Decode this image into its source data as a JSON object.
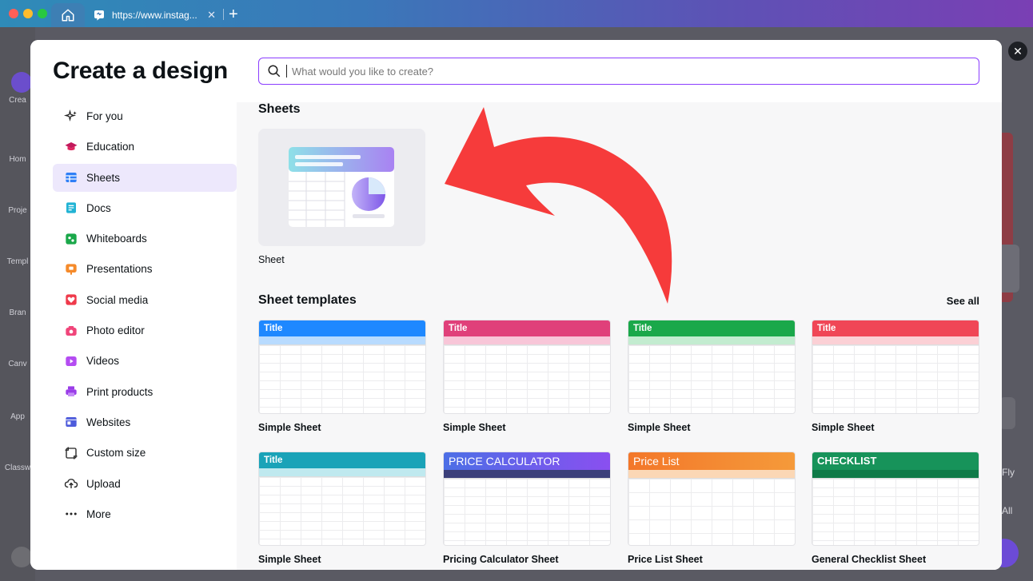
{
  "browser": {
    "tab_url": "https://www.instag...",
    "colors": {
      "close": "#ff5f57",
      "min": "#febc2e",
      "max": "#28c840"
    }
  },
  "background_app": {
    "sidebar_labels": [
      "Crea",
      "Hom",
      "Proje",
      "Templ",
      "Bran",
      "Canv",
      "App",
      "Classw"
    ],
    "right_labels": [
      "Fly",
      "All"
    ]
  },
  "modal": {
    "title": "Create a design",
    "search_placeholder": "What would you like to create?",
    "nav": [
      {
        "label": "For you",
        "icon": "sparkles-icon",
        "active": false
      },
      {
        "label": "Education",
        "icon": "graduation-cap-icon",
        "active": false
      },
      {
        "label": "Sheets",
        "icon": "sheets-icon",
        "active": true
      },
      {
        "label": "Docs",
        "icon": "docs-icon",
        "active": false
      },
      {
        "label": "Whiteboards",
        "icon": "whiteboard-icon",
        "active": false
      },
      {
        "label": "Presentations",
        "icon": "presentation-icon",
        "active": false
      },
      {
        "label": "Social media",
        "icon": "heart-icon",
        "active": false
      },
      {
        "label": "Photo editor",
        "icon": "camera-icon",
        "active": false
      },
      {
        "label": "Videos",
        "icon": "video-icon",
        "active": false
      },
      {
        "label": "Print products",
        "icon": "printer-icon",
        "active": false
      },
      {
        "label": "Websites",
        "icon": "website-icon",
        "active": false
      },
      {
        "label": "Custom size",
        "icon": "crop-icon",
        "active": false
      },
      {
        "label": "Upload",
        "icon": "cloud-upload-icon",
        "active": false
      },
      {
        "label": "More",
        "icon": "more-dots-icon",
        "active": false
      }
    ],
    "sheets_section": {
      "title": "Sheets",
      "card_label": "Sheet"
    },
    "templates_section": {
      "title": "Sheet templates",
      "see_all": "See all",
      "templates": [
        {
          "name": "Simple Sheet",
          "header": "Title",
          "color": "#1e88ff"
        },
        {
          "name": "Simple Sheet",
          "header": "Title",
          "color": "#e0407a"
        },
        {
          "name": "Simple Sheet",
          "header": "Title",
          "color": "#1aa84a"
        },
        {
          "name": "Simple Sheet",
          "header": "Title",
          "color": "#f04656"
        },
        {
          "name": "Simple Sheet",
          "header": "Title",
          "color": "#1aa3b8"
        },
        {
          "name": "Pricing Calculator Sheet",
          "header": "PRICE CALCULATOR",
          "color": "#5b5bdc"
        },
        {
          "name": "Price List Sheet",
          "header": "Price List",
          "color": "#f3772a"
        },
        {
          "name": "General Checklist Sheet",
          "header": "CHECKLIST",
          "color": "#17935a"
        }
      ]
    }
  },
  "colors": {
    "accent": "#8b3dff",
    "arrow": "#f63b3b"
  }
}
